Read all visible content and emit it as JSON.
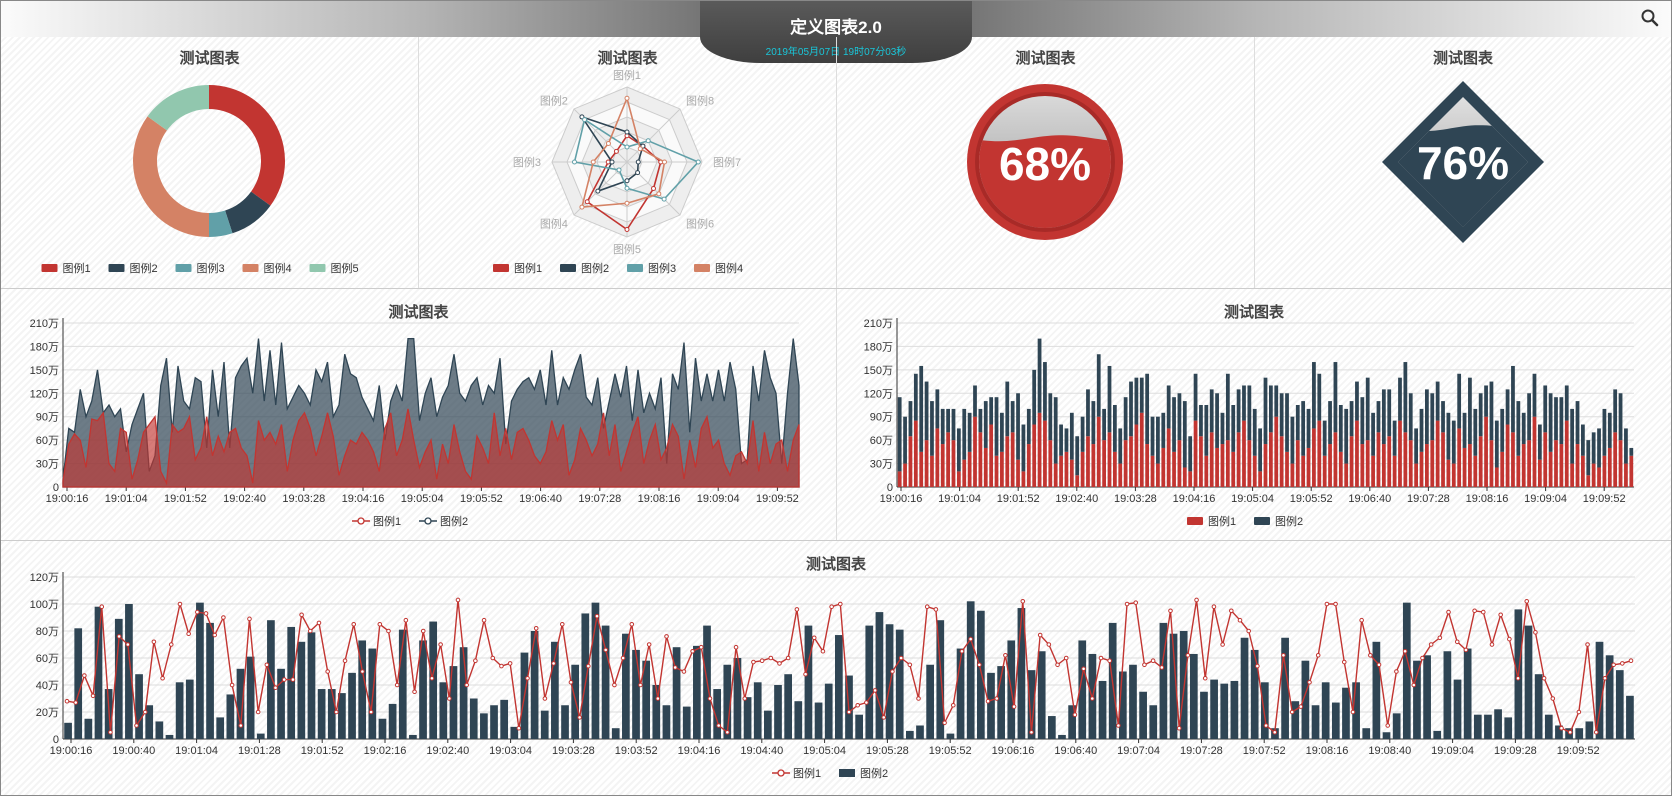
{
  "header": {
    "title": "定义图表2.0",
    "datetime": "2019年05月07日 19时07分03秒"
  },
  "colors": {
    "red": "#c23531",
    "navy": "#2f4554",
    "teal": "#61a0a8",
    "orange": "#d48265",
    "green": "#91c7ae"
  },
  "panels": {
    "donut": {
      "title": "测试图表",
      "legend": [
        "图例1",
        "图例2",
        "图例3",
        "图例4",
        "图例5"
      ]
    },
    "radar": {
      "title": "测试图表",
      "legend": [
        "图例1",
        "图例2",
        "图例3",
        "图例4"
      ]
    },
    "gauge_circle": {
      "title": "测试图表",
      "value_text": "68%"
    },
    "gauge_diamond": {
      "title": "测试图表",
      "value_text": "76%"
    },
    "area": {
      "title": "测试图表",
      "legend": [
        "图例1",
        "图例2"
      ]
    },
    "bar": {
      "title": "测试图表",
      "legend": [
        "图例1",
        "图例2"
      ]
    },
    "combo": {
      "title": "测试图表",
      "legend": [
        "图例1",
        "图例2"
      ]
    }
  },
  "chart_data": [
    {
      "type": "pie",
      "title": "测试图表",
      "donut": true,
      "categories": [
        "图例1",
        "图例2",
        "图例3",
        "图例4",
        "图例5"
      ],
      "values": [
        35,
        10,
        5,
        35,
        15
      ],
      "colors": [
        "#c23531",
        "#2f4554",
        "#61a0a8",
        "#d48265",
        "#91c7ae"
      ]
    },
    {
      "type": "radar",
      "title": "测试图表",
      "indicators": [
        "图例1",
        "图例8",
        "图例7",
        "图例6",
        "图例5",
        "图例4",
        "图例3",
        "图例2"
      ],
      "series": [
        {
          "name": "图例1",
          "color": "#c23531",
          "values": [
            0.35,
            0.3,
            0.45,
            0.5,
            0.9,
            0.75,
            0.25,
            0.2
          ]
        },
        {
          "name": "图例2",
          "color": "#2f4554",
          "values": [
            0.4,
            0.3,
            0.15,
            0.2,
            0.25,
            0.55,
            0.2,
            0.85
          ]
        },
        {
          "name": "图例3",
          "color": "#61a0a8",
          "values": [
            0.2,
            0.4,
            0.95,
            0.7,
            0.35,
            0.15,
            0.7,
            0.8
          ]
        },
        {
          "name": "图例4",
          "color": "#d48265",
          "values": [
            0.85,
            0.25,
            0.5,
            0.6,
            0.55,
            0.85,
            0.45,
            0.35
          ]
        }
      ]
    },
    {
      "type": "gauge",
      "title": "测试图表",
      "value": 68,
      "unit": "%",
      "color": "#c23531"
    },
    {
      "type": "gauge",
      "title": "测试图表",
      "value": 76,
      "unit": "%",
      "color": "#2f4554"
    },
    {
      "type": "area",
      "title": "测试图表",
      "ylim": [
        0,
        2100000
      ],
      "yticks": [
        0,
        300000,
        600000,
        900000,
        1200000,
        1500000,
        1800000,
        2100000
      ],
      "ytick_labels": [
        "0",
        "30万",
        "60万",
        "90万",
        "120万",
        "150万",
        "180万",
        "210万"
      ],
      "xtick_labels": [
        "19:00:16",
        "19:01:04",
        "19:01:52",
        "19:02:40",
        "19:03:28",
        "19:04:16",
        "19:05:04",
        "19:05:52",
        "19:06:40",
        "19:07:28",
        "19:08:16",
        "19:09:04",
        "19:09:52"
      ],
      "series": [
        {
          "name": "图例1",
          "color": "#c23531",
          "values": [
            8,
            55,
            68,
            60,
            25,
            87,
            85,
            95,
            30,
            20,
            75,
            70,
            10,
            35,
            70,
            80,
            90,
            20,
            5,
            80,
            70,
            75,
            90,
            35,
            50,
            90,
            40,
            65,
            45,
            70,
            75,
            50,
            40,
            5,
            85,
            60,
            70,
            55,
            80,
            20,
            60,
            85,
            95,
            75,
            40,
            65,
            95,
            65,
            15,
            40,
            60,
            55,
            70,
            60,
            45,
            20,
            75,
            95,
            40,
            60,
            100,
            60,
            25,
            45,
            60,
            10,
            55,
            30,
            80,
            45,
            20,
            10,
            65,
            50,
            30,
            95,
            40,
            75,
            35,
            70,
            75,
            60,
            40,
            30,
            45,
            85,
            60,
            80,
            15,
            35,
            75,
            60,
            40,
            55,
            95,
            40,
            80,
            20,
            45,
            70,
            90,
            30,
            60,
            80,
            35,
            50,
            80,
            65,
            10,
            60,
            25,
            75,
            90,
            50,
            60,
            30,
            15,
            40,
            45,
            30,
            85,
            20,
            70,
            30,
            55,
            60,
            20,
            60,
            80
          ]
        },
        {
          "name": "图例2",
          "color": "#2f4554",
          "values": [
            10,
            75,
            70,
            125,
            90,
            110,
            150,
            95,
            105,
            90,
            100,
            45,
            80,
            100,
            120,
            20,
            40,
            130,
            165,
            70,
            155,
            110,
            100,
            140,
            135,
            50,
            150,
            90,
            160,
            50,
            140,
            155,
            165,
            120,
            190,
            110,
            175,
            105,
            185,
            100,
            115,
            130,
            120,
            105,
            150,
            135,
            160,
            90,
            105,
            170,
            145,
            140,
            115,
            100,
            85,
            130,
            60,
            110,
            130,
            110,
            190,
            190,
            85,
            120,
            140,
            90,
            115,
            130,
            170,
            120,
            110,
            130,
            140,
            105,
            130,
            120,
            165,
            55,
            110,
            125,
            135,
            140,
            125,
            150,
            105,
            175,
            105,
            140,
            125,
            150,
            170,
            115,
            105,
            140,
            75,
            110,
            145,
            115,
            155,
            85,
            150,
            95,
            120,
            100,
            140,
            30,
            145,
            125,
            185,
            70,
            165,
            110,
            145,
            110,
            150,
            110,
            160,
            125,
            30,
            35,
            155,
            110,
            175,
            140,
            120,
            30,
            120,
            190,
            130
          ]
        }
      ]
    },
    {
      "type": "bar",
      "title": "测试图表",
      "stacked": true,
      "ylim": [
        0,
        2100000
      ],
      "yticks": [
        0,
        300000,
        600000,
        900000,
        1200000,
        1500000,
        1800000,
        2100000
      ],
      "ytick_labels": [
        "0",
        "30万",
        "60万",
        "90万",
        "120万",
        "150万",
        "180万",
        "210万"
      ],
      "xtick_labels": [
        "19:00:16",
        "19:01:04",
        "19:01:52",
        "19:02:40",
        "19:03:28",
        "19:04:16",
        "19:05:04",
        "19:05:52",
        "19:06:40",
        "19:07:28",
        "19:08:16",
        "19:09:04",
        "19:09:52"
      ],
      "series": [
        {
          "name": "图例1",
          "color": "#c23531",
          "values": [
            20,
            30,
            65,
            85,
            45,
            60,
            40,
            75,
            55,
            70,
            60,
            20,
            35,
            45,
            90,
            70,
            50,
            80,
            40,
            45,
            65,
            70,
            35,
            20,
            55,
            80,
            95,
            85,
            60,
            30,
            40,
            45,
            35,
            15,
            45,
            65,
            55,
            90,
            60,
            70,
            45,
            30,
            60,
            65,
            80,
            95,
            55,
            40,
            30,
            50,
            75,
            45,
            60,
            25,
            20,
            85,
            65,
            40,
            70,
            50,
            55,
            60,
            45,
            70,
            85,
            60,
            40,
            20,
            55,
            70,
            90,
            65,
            45,
            30,
            60,
            40,
            50,
            75,
            85,
            40,
            55,
            70,
            45,
            30,
            65,
            85,
            55,
            60,
            40,
            70,
            55,
            65,
            40,
            85,
            70,
            60,
            30,
            45,
            55,
            60,
            85,
            70,
            35,
            30,
            75,
            50,
            55,
            40,
            65,
            90,
            60,
            25,
            45,
            80,
            70,
            40,
            55,
            60,
            90,
            35,
            70,
            45,
            60,
            55,
            85,
            30,
            55,
            40,
            15,
            30,
            25,
            40,
            50,
            70,
            60,
            30,
            40
          ]
        },
        {
          "name": "图例2",
          "color": "#2f4554",
          "values": [
            95,
            60,
            45,
            60,
            110,
            75,
            70,
            50,
            45,
            30,
            40,
            55,
            65,
            50,
            40,
            30,
            60,
            35,
            75,
            50,
            70,
            40,
            85,
            60,
            45,
            70,
            95,
            75,
            60,
            85,
            40,
            30,
            60,
            50,
            45,
            60,
            55,
            80,
            40,
            85,
            60,
            45,
            55,
            70,
            60,
            45,
            90,
            50,
            60,
            45,
            55,
            70,
            60,
            85,
            45,
            60,
            40,
            65,
            55,
            70,
            40,
            85,
            60,
            55,
            45,
            70,
            60,
            55,
            85,
            60,
            40,
            55,
            75,
            60,
            45,
            70,
            50,
            85,
            60,
            45,
            55,
            90,
            60,
            70,
            45,
            50,
            60,
            80,
            55,
            40,
            70,
            60,
            45,
            55,
            90,
            60,
            45,
            55,
            70,
            60,
            50,
            40,
            60,
            55,
            70,
            45,
            85,
            60,
            55,
            40,
            75,
            60,
            55,
            45,
            85,
            70,
            40,
            60,
            55,
            45,
            60,
            75,
            55,
            60,
            45,
            70,
            55,
            40,
            45,
            40,
            50,
            60,
            45,
            55,
            60,
            45,
            10
          ]
        }
      ]
    },
    {
      "type": "bar+line",
      "title": "测试图表",
      "ylim": [
        0,
        1200000
      ],
      "yticks": [
        0,
        200000,
        400000,
        600000,
        800000,
        1000000,
        1200000
      ],
      "ytick_labels": [
        "0",
        "20万",
        "40万",
        "60万",
        "80万",
        "100万",
        "120万"
      ],
      "xtick_labels": [
        "19:00:16",
        "19:00:40",
        "19:01:04",
        "19:01:28",
        "19:01:52",
        "19:02:16",
        "19:02:40",
        "19:03:04",
        "19:03:28",
        "19:03:52",
        "19:04:16",
        "19:04:40",
        "19:05:04",
        "19:05:28",
        "19:05:52",
        "19:06:16",
        "19:06:40",
        "19:07:04",
        "19:07:28",
        "19:07:52",
        "19:08:16",
        "19:08:40",
        "19:09:04",
        "19:09:28",
        "19:09:52"
      ],
      "series": [
        {
          "name": "图例1",
          "type": "line",
          "color": "#c23531",
          "values": [
            28,
            27,
            47,
            32,
            98,
            5,
            76,
            70,
            10,
            20,
            72,
            45,
            70,
            100,
            78,
            94,
            93,
            77,
            90,
            40,
            10,
            89,
            20,
            55,
            38,
            44,
            44,
            92,
            80,
            86,
            50,
            20,
            58,
            85,
            50,
            20,
            85,
            80,
            40,
            88,
            35,
            80,
            45,
            70,
            30,
            103,
            40,
            58,
            88,
            60,
            54,
            56,
            8,
            45,
            82,
            30,
            56,
            85,
            42,
            16,
            54,
            91,
            66,
            40,
            60,
            85,
            40,
            70,
            30,
            76,
            53,
            50,
            65,
            68,
            30,
            10,
            5,
            68,
            30,
            57,
            58,
            60,
            56,
            60,
            96,
            48,
            75,
            65,
            98,
            100,
            20,
            25,
            27,
            36,
            16,
            50,
            60,
            55,
            30,
            98,
            96,
            12,
            25,
            65,
            74,
            55,
            28,
            30,
            62,
            24,
            102,
            5,
            77,
            70,
            55,
            60,
            18,
            52,
            30,
            60,
            58,
            10,
            100,
            101,
            55,
            58,
            53,
            95,
            8,
            62,
            103,
            45,
            98,
            70,
            95,
            88,
            80,
            54,
            10,
            5,
            62,
            20,
            24,
            42,
            62,
            100,
            100,
            57,
            20,
            88,
            62,
            55,
            10,
            50,
            65,
            40,
            60,
            70,
            75,
            94,
            72,
            66,
            95,
            94,
            70,
            92,
            74,
            45,
            102,
            79,
            45,
            30,
            8,
            5,
            20,
            70,
            5,
            45,
            55,
            56,
            58
          ]
        },
        {
          "name": "图例2",
          "type": "bar",
          "color": "#2f4554",
          "values": [
            12,
            82,
            15,
            98,
            37,
            89,
            100,
            48,
            25,
            13,
            3,
            42,
            44,
            101,
            86,
            16,
            33,
            52,
            61,
            4,
            88,
            52,
            83,
            72,
            79,
            37,
            37,
            34,
            49,
            73,
            67,
            15,
            26,
            81,
            3,
            73,
            87,
            42,
            54,
            68,
            30,
            19,
            25,
            29,
            9,
            64,
            80,
            21,
            72,
            25,
            55,
            93,
            101,
            84,
            8,
            78,
            66,
            58,
            40,
            25,
            68,
            24,
            69,
            84,
            37,
            55,
            60,
            31,
            42,
            21,
            40,
            48,
            28,
            84,
            27,
            41,
            77,
            47,
            18,
            84,
            94,
            85,
            81,
            6,
            10,
            55,
            88,
            4,
            67,
            102,
            95,
            49,
            54,
            73,
            97,
            51,
            65,
            17,
            3,
            25,
            73,
            63,
            43,
            86,
            50,
            55,
            35,
            25,
            86,
            78,
            80,
            63,
            35,
            44,
            41,
            43,
            75,
            66,
            42,
            8,
            75,
            28,
            58,
            25,
            42,
            27,
            38,
            42,
            8,
            72,
            5,
            19,
            101,
            58,
            62,
            6,
            65,
            44,
            67,
            18,
            18,
            22,
            16,
            96,
            84,
            48,
            18,
            10,
            8,
            8,
            13,
            72,
            62,
            51,
            32
          ]
        }
      ]
    }
  ]
}
